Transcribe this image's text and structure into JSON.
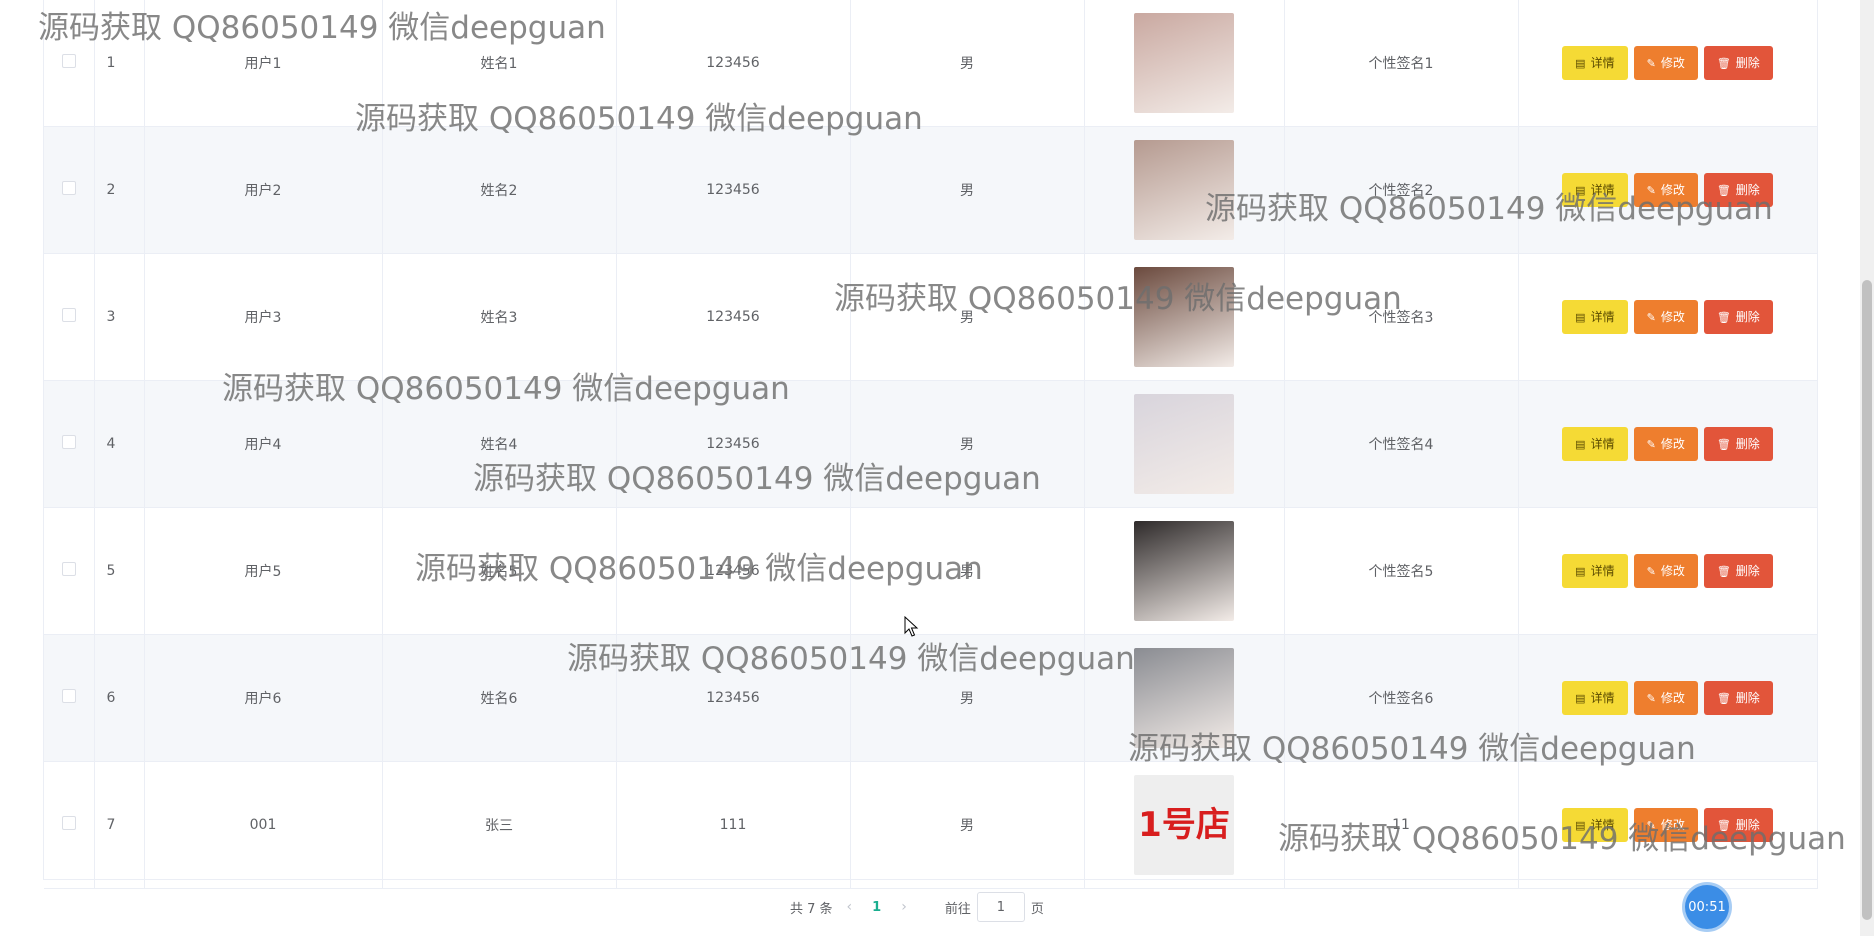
{
  "table": {
    "rows": [
      {
        "index": "1",
        "username": "用户1",
        "name": "姓名1",
        "password": "123456",
        "gender": "男",
        "avatar_color": "#c9a8a0",
        "signature": "个性签名1"
      },
      {
        "index": "2",
        "username": "用户2",
        "name": "姓名2",
        "password": "123456",
        "gender": "男",
        "avatar_color": "#b59a90",
        "signature": "个性签名2"
      },
      {
        "index": "3",
        "username": "用户3",
        "name": "姓名3",
        "password": "123456",
        "gender": "男",
        "avatar_color": "#6b4a3e",
        "signature": "个性签名3"
      },
      {
        "index": "4",
        "username": "用户4",
        "name": "姓名4",
        "password": "123456",
        "gender": "男",
        "avatar_color": "#d8d4dc",
        "signature": "个性签名4"
      },
      {
        "index": "5",
        "username": "用户5",
        "name": "姓名5",
        "password": "123456",
        "gender": "男",
        "avatar_color": "#2e2a2a",
        "signature": "个性签名5"
      },
      {
        "index": "6",
        "username": "用户6",
        "name": "姓名6",
        "password": "123456",
        "gender": "男",
        "avatar_color": "#8a8c92",
        "signature": "个性签名6"
      },
      {
        "index": "7",
        "username": "001",
        "name": "张三",
        "password": "111",
        "gender": "男",
        "avatar_color": "#eeeeee",
        "signature": "11"
      }
    ],
    "actions": {
      "detail_label": "详情",
      "edit_label": "修改",
      "delete_label": "删除"
    }
  },
  "pagination": {
    "total_text": "共 7 条",
    "current_page": "1",
    "jump_prefix": "前往",
    "jump_value": "1",
    "jump_suffix": "页",
    "prev_icon": "chevron-left-icon",
    "next_icon": "chevron-right-icon"
  },
  "timer": {
    "label": "00:51"
  },
  "logo": {
    "text": "1号店"
  },
  "watermark": {
    "text": "源码获取 QQ86050149 微信deepguan"
  }
}
